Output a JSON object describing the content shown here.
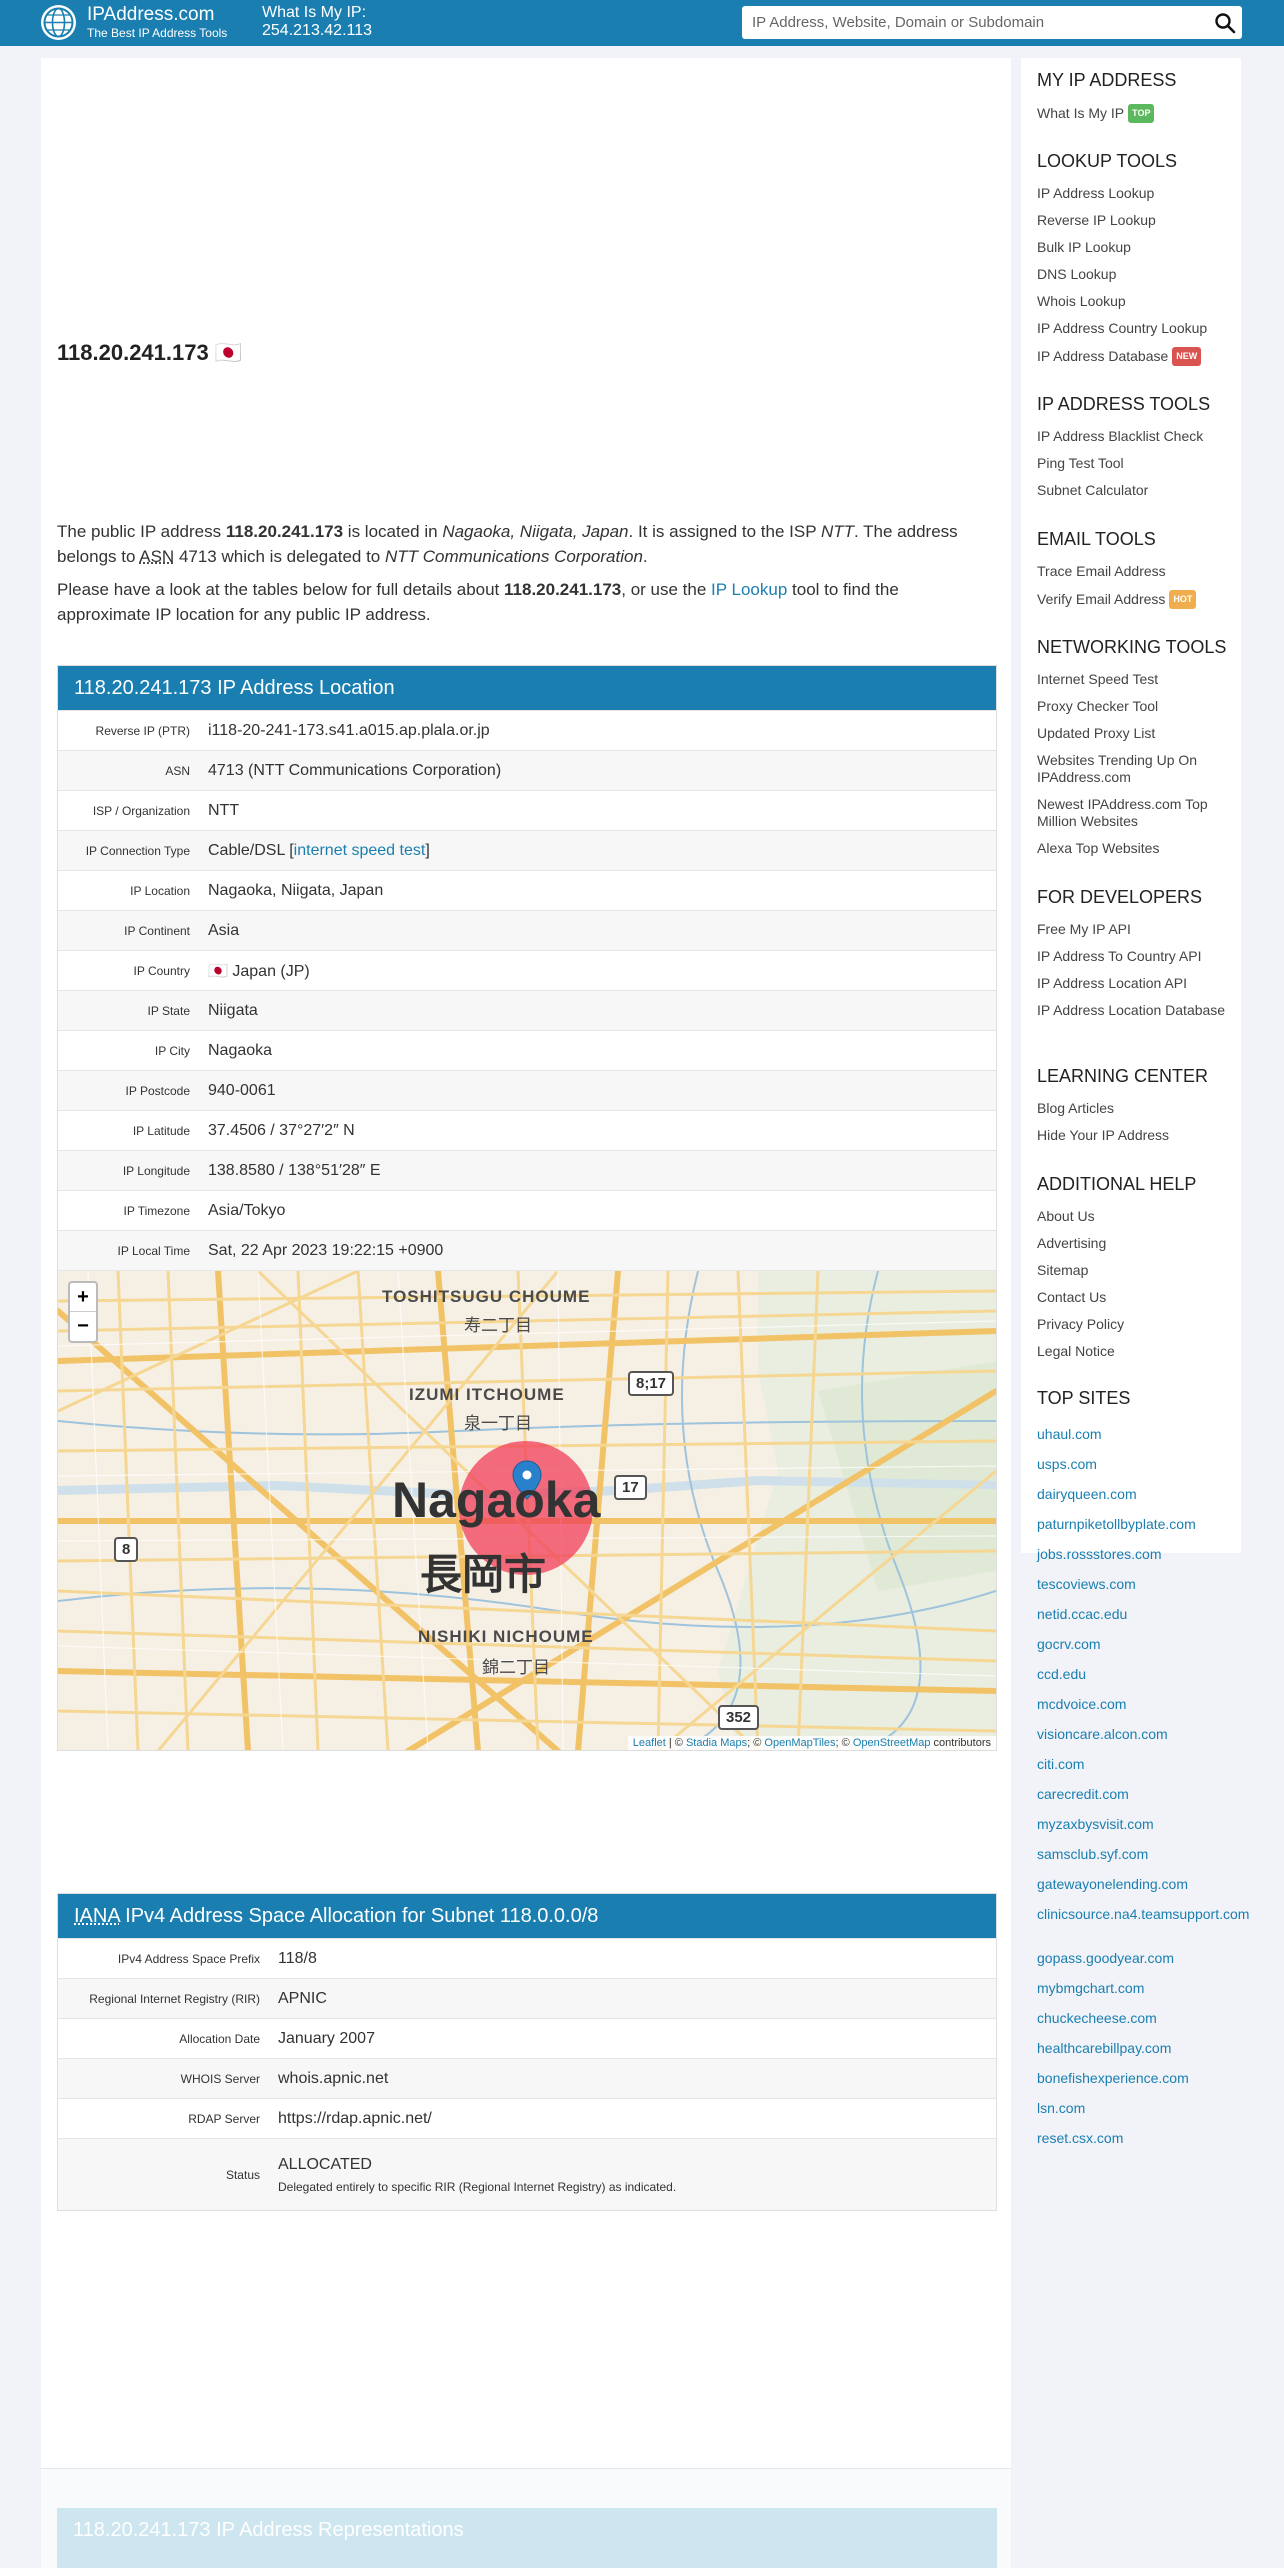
{
  "header": {
    "site_name": "IPAddress.com",
    "tagline": "The Best IP Address Tools",
    "myip_label": "What Is My IP:",
    "myip_value": "254.213.42.113",
    "search_placeholder": "IP Address, Website, Domain or Subdomain"
  },
  "page": {
    "title": "118.20.241.173 🇯🇵",
    "intro1": [
      {
        "t": "The public IP address ",
        "s": "n"
      },
      {
        "t": "118.20.241.173",
        "s": "b"
      },
      {
        "t": " is located in ",
        "s": "n"
      },
      {
        "t": "Nagaoka, Niigata, Japan",
        "s": "i"
      },
      {
        "t": ". It is assigned to the ISP ",
        "s": "n"
      },
      {
        "t": "NTT",
        "s": "i"
      },
      {
        "t": ". The address belongs to ",
        "s": "n"
      },
      {
        "t": "ASN",
        "s": "u"
      },
      {
        "t": " 4713 which is delegated to ",
        "s": "n"
      },
      {
        "t": "NTT Communications Corporation",
        "s": "i"
      },
      {
        "t": ".",
        "s": "n"
      }
    ],
    "intro2": [
      {
        "t": "Please have a look at the tables below for full details about ",
        "s": "n"
      },
      {
        "t": "118.20.241.173",
        "s": "b"
      },
      {
        "t": ", or use the ",
        "s": "n"
      },
      {
        "t": "IP Lookup",
        "s": "a"
      },
      {
        "t": " tool to find the approximate IP location for any public IP address.",
        "s": "n"
      }
    ]
  },
  "location_card": {
    "title": "118.20.241.173 IP Address Location",
    "rows": [
      {
        "k": "Reverse IP (PTR)",
        "v": "i118-20-241-173.s41.a015.ap.plala.or.jp",
        "link": true
      },
      {
        "k": "ASN",
        "v": "4713 (NTT Communications Corporation)"
      },
      {
        "k": "ISP / Organization",
        "v": "NTT"
      },
      {
        "k": "IP Connection Type",
        "v": "Cable/DSL",
        "extra_link": "internet speed test"
      },
      {
        "k": "IP Location",
        "v": "Nagaoka, Niigata, Japan"
      },
      {
        "k": "IP Continent",
        "v": "Asia"
      },
      {
        "k": "IP Country",
        "v": "🇯🇵 Japan (JP)"
      },
      {
        "k": "IP State",
        "v": "Niigata"
      },
      {
        "k": "IP City",
        "v": "Nagaoka"
      },
      {
        "k": "IP Postcode",
        "v": "940-0061"
      },
      {
        "k": "IP Latitude",
        "v": "37.4506 / 37°27′2″ N"
      },
      {
        "k": "IP Longitude",
        "v": "138.8580 / 138°51′28″ E"
      },
      {
        "k": "IP Timezone",
        "v": "Asia/Tokyo"
      },
      {
        "k": "IP Local Time",
        "v": "Sat, 22 Apr 2023 19:22:15 +0900"
      }
    ]
  },
  "map": {
    "zoom_in": "+",
    "zoom_out": "−",
    "labels": {
      "toshitsugu": "TOSHITSUGU CHOUME",
      "toshitsugu_jp": "寿二丁目",
      "izumi": "IZUMI ITCHOUME",
      "izumi_jp": "泉一丁目",
      "city": "Nagaoka",
      "city_jp": "長岡市",
      "nishiki": "NISHIKI NICHOUME",
      "nishiki_jp": "錦二丁目",
      "road_817": "8;17",
      "road_17": "17",
      "road_8": "8",
      "road_352": "352"
    },
    "attribution": {
      "leaflet": "Leaflet",
      "sep1": " | © ",
      "stadia": "Stadia Maps",
      "sep2": "; © ",
      "omt": "OpenMapTiles",
      "sep3": "; © ",
      "osm": "OpenStreetMap",
      "tail": " contributors"
    }
  },
  "iana_card": {
    "title_abbr": "IANA",
    "title_rest": " IPv4 Address Space Allocation for Subnet 118.0.0.0/8",
    "rows": [
      {
        "k": "IPv4 Address Space Prefix",
        "v": "118/8"
      },
      {
        "k": "Regional Internet Registry (RIR)",
        "v": "APNIC"
      },
      {
        "k": "Allocation Date",
        "v": "January 2007"
      },
      {
        "k": "WHOIS Server",
        "v": "whois.apnic.net"
      },
      {
        "k": "RDAP Server",
        "v": "https://rdap.apnic.net/"
      }
    ],
    "status_label": "Status",
    "status_value": "ALLOCATED",
    "status_note": "Delegated entirely to specific RIR (Regional Internet Registry) as indicated."
  },
  "representations_card": {
    "title": "118.20.241.173 IP Address Representations"
  },
  "sidebar": {
    "sections": [
      {
        "title": "MY IP ADDRESS",
        "items": [
          {
            "label": "What Is My IP",
            "badge": "TOP",
            "badge_color": "#5cb85c"
          }
        ]
      },
      {
        "title": "LOOKUP TOOLS",
        "items": [
          {
            "label": "IP Address Lookup"
          },
          {
            "label": "Reverse IP Lookup"
          },
          {
            "label": "Bulk IP Lookup"
          },
          {
            "label": "DNS Lookup"
          },
          {
            "label": "Whois Lookup"
          },
          {
            "label": "IP Address Country Lookup"
          },
          {
            "label": "IP Address Database",
            "badge": "NEW",
            "badge_color": "#d9534f"
          }
        ]
      },
      {
        "title": "IP ADDRESS TOOLS",
        "items": [
          {
            "label": "IP Address Blacklist Check"
          },
          {
            "label": "Ping Test Tool"
          },
          {
            "label": "Subnet Calculator"
          }
        ]
      },
      {
        "title": "EMAIL TOOLS",
        "items": [
          {
            "label": "Trace Email Address"
          },
          {
            "label": "Verify Email Address",
            "badge": "HOT",
            "badge_color": "#f0ad4e"
          }
        ]
      },
      {
        "title": "NETWORKING TOOLS",
        "items": [
          {
            "label": "Internet Speed Test"
          },
          {
            "label": "Proxy Checker Tool"
          },
          {
            "label": "Updated Proxy List"
          },
          {
            "label": "Websites Trending Up On IPAddress.com",
            "lines": 2
          },
          {
            "label": "Newest IPAddress.com Top Million Websites",
            "lines": 2
          },
          {
            "label": "Alexa Top Websites"
          }
        ]
      },
      {
        "title": "FOR DEVELOPERS",
        "items": [
          {
            "label": "Free My IP API"
          },
          {
            "label": "IP Address To Country API"
          },
          {
            "label": "IP Address Location API"
          },
          {
            "label": "IP Address Location Database",
            "lines": 2
          }
        ]
      },
      {
        "title": "LEARNING CENTER",
        "items": [
          {
            "label": "Blog Articles"
          },
          {
            "label": "Hide Your IP Address"
          }
        ]
      },
      {
        "title": "ADDITIONAL HELP",
        "items": [
          {
            "label": "About Us"
          },
          {
            "label": "Advertising"
          },
          {
            "label": "Sitemap"
          },
          {
            "label": "Contact Us"
          },
          {
            "label": "Privacy Policy"
          },
          {
            "label": "Legal Notice"
          }
        ]
      }
    ],
    "top_sites_title": "TOP SITES",
    "top_sites": [
      "uhaul.com",
      "usps.com",
      "dairyqueen.com",
      "paturnpiketollbyplate.com",
      "jobs.rossstores.com",
      "tescoviews.com",
      "netid.ccac.edu",
      "gocrv.com",
      "ccd.edu",
      "mcdvoice.com",
      "visioncare.alcon.com",
      "citi.com",
      "carecredit.com",
      "myzaxbysvisit.com",
      "samsclub.syf.com",
      "gatewayonelending.com",
      "clinicsource.na4.teamsupport.com",
      "gopass.goodyear.com",
      "mybmgchart.com",
      "chuckecheese.com",
      "healthcarebillpay.com",
      "bonefishexperience.com",
      "lsn.com",
      "reset.csx.com"
    ]
  }
}
